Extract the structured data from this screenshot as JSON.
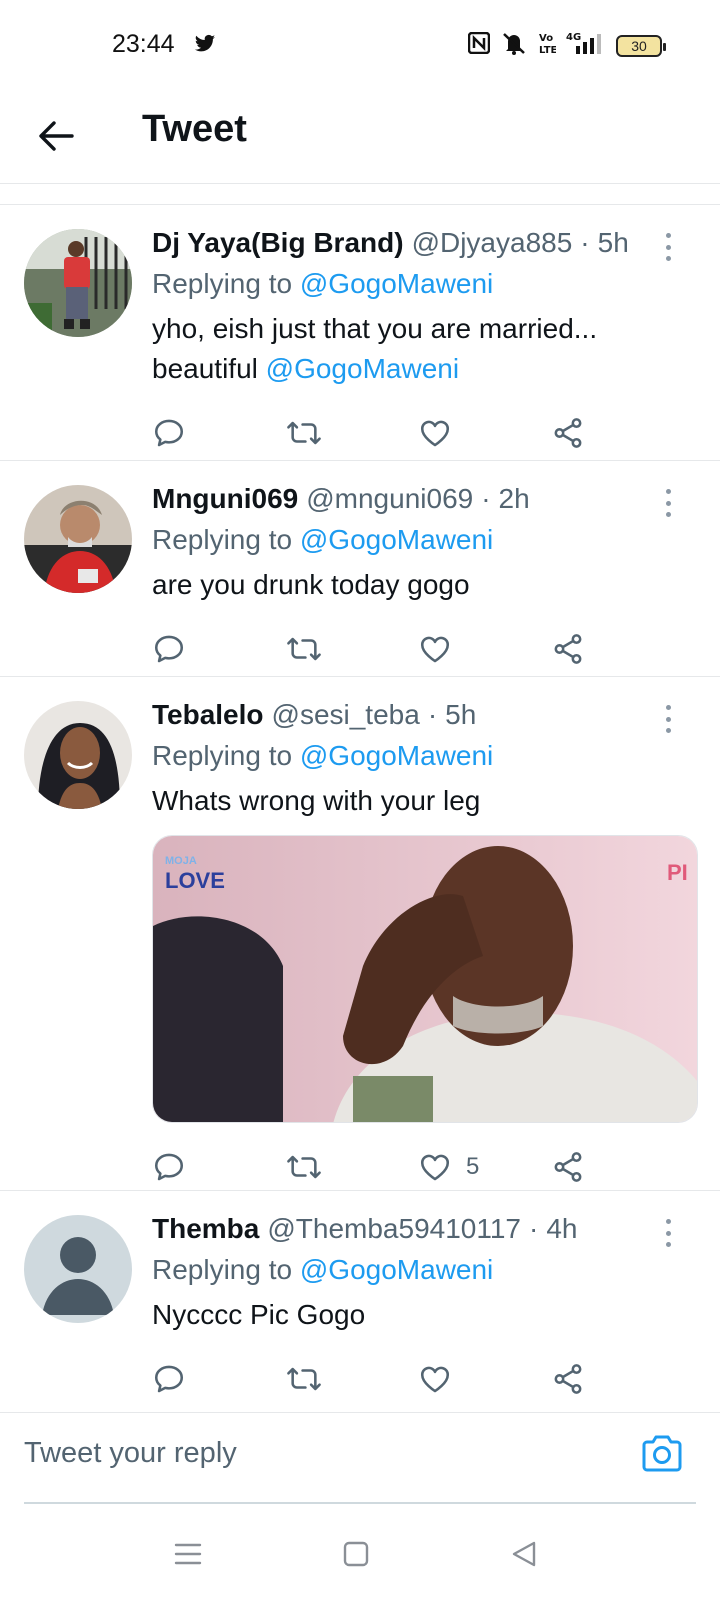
{
  "status_bar": {
    "time": "23:44",
    "battery": "30",
    "icons": [
      "twitter-icon",
      "nfc-icon",
      "mute-icon",
      "volte-icon",
      "4g-signal-icon",
      "battery-icon"
    ]
  },
  "header": {
    "title": "Tweet"
  },
  "colors": {
    "accent": "#1d9bf0",
    "text": "#0f1419",
    "secondary": "#536471",
    "divider": "#e6e8ea"
  },
  "tweets": [
    {
      "display_name": "Dj Yaya(Big Brand)",
      "handle": "@Djyaya885",
      "time": "5h",
      "replying_label": "Replying to",
      "replying_to": "@GogoMaweni",
      "text": "yho, eish just that you are married... beautiful",
      "text_mention": "@GogoMaweni",
      "likes": ""
    },
    {
      "display_name": "Mnguni069",
      "handle": "@mnguni069",
      "time": "2h",
      "replying_label": "Replying to",
      "replying_to": "@GogoMaweni",
      "text": "are you drunk today gogo",
      "likes": ""
    },
    {
      "display_name": "Tebalelo",
      "handle": "@sesi_teba",
      "time": "5h",
      "replying_label": "Replying to",
      "replying_to": "@GogoMaweni",
      "text": "Whats wrong with your leg",
      "media": {
        "brand_small": "MOJA",
        "brand_big": "LOVE",
        "corner_text": "PI"
      },
      "likes": "5"
    },
    {
      "display_name": "Themba",
      "handle": "@Themba59410117",
      "time": "4h",
      "replying_label": "Replying to",
      "replying_to": "@GogoMaweni",
      "text": "Nycccc Pic Gogo",
      "likes": ""
    }
  ],
  "reply_bar": {
    "placeholder": "Tweet your reply"
  },
  "nav_bar": {
    "buttons": [
      "menu-icon",
      "home-square-icon",
      "back-triangle-icon"
    ]
  }
}
